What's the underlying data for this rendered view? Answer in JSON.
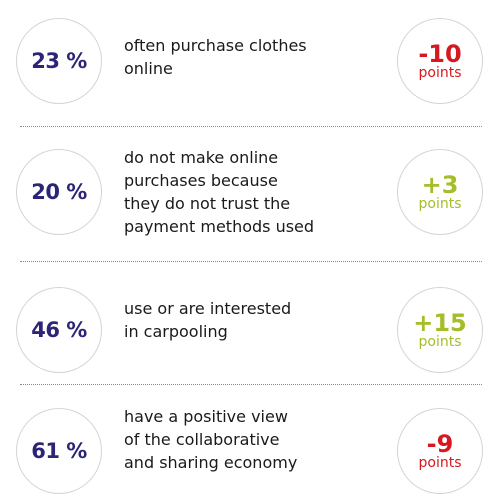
{
  "rows": [
    {
      "percent": "23 %",
      "lines": [
        "often purchase clothes",
        "online"
      ],
      "delta": "-10",
      "unit": "points",
      "trend": "negative"
    },
    {
      "percent": "20 %",
      "lines": [
        "do not make online",
        "purchases because",
        "they do not trust the",
        "payment methods used"
      ],
      "delta": "+3",
      "unit": "points",
      "trend": "positive"
    },
    {
      "percent": "46 %",
      "lines": [
        "use or are interested",
        "in carpooling"
      ],
      "delta": "+15",
      "unit": "points",
      "trend": "positive"
    },
    {
      "percent": "61 %",
      "lines": [
        "have a positive view",
        "of the collaborative",
        "and sharing economy"
      ],
      "delta": "-9",
      "unit": "points",
      "trend": "negative"
    }
  ],
  "colors": {
    "percent": "#2b2477",
    "negative": "#d7191f",
    "positive": "#a6bd2a",
    "circle_border": "#d4d4d4",
    "separator": "#8a8a8a"
  }
}
